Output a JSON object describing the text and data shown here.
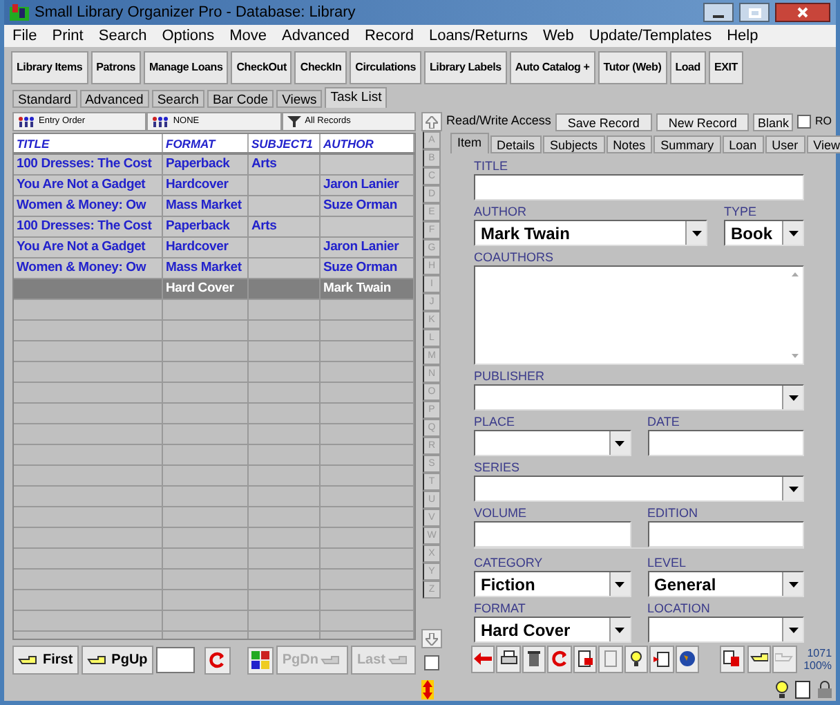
{
  "window": {
    "title": "Small Library Organizer Pro - Database: Library"
  },
  "menu": [
    "File",
    "Print",
    "Search",
    "Options",
    "Move",
    "Advanced",
    "Record",
    "Loans/Returns",
    "Web",
    "Update/Templates",
    "Help"
  ],
  "toolbar": [
    "Library Items",
    "Patrons",
    "Manage Loans",
    "CheckOut",
    "CheckIn",
    "Circulations",
    "Library Labels",
    "Auto Catalog +",
    "Tutor (Web)",
    "Load",
    "EXIT"
  ],
  "view_tabs": [
    {
      "label": "Standard",
      "selected": false
    },
    {
      "label": "Advanced",
      "selected": false
    },
    {
      "label": "Search",
      "selected": false
    },
    {
      "label": "Bar Code",
      "selected": false
    },
    {
      "label": "Views",
      "selected": false
    },
    {
      "label": "Task List",
      "selected": true
    }
  ],
  "sort_bar": [
    {
      "label": "Entry Order",
      "kind": "people"
    },
    {
      "label": "NONE",
      "kind": "people"
    },
    {
      "label": "All Records",
      "kind": "filter"
    }
  ],
  "table": {
    "columns": [
      "TITLE",
      "FORMAT",
      "SUBJECT1",
      "AUTHOR"
    ],
    "rows": [
      {
        "cells": [
          "100 Dresses: The Cost",
          "Paperback",
          "Arts",
          ""
        ],
        "selected": false
      },
      {
        "cells": [
          "You Are Not a Gadget",
          "Hardcover",
          "",
          "Jaron Lanier"
        ],
        "selected": false
      },
      {
        "cells": [
          "Women & Money: Ow",
          "Mass Market",
          "",
          "Suze Orman"
        ],
        "selected": false
      },
      {
        "cells": [
          "100 Dresses: The Cost",
          "Paperback",
          "Arts",
          ""
        ],
        "selected": false
      },
      {
        "cells": [
          "You Are Not a Gadget",
          "Hardcover",
          "",
          "Jaron Lanier"
        ],
        "selected": false
      },
      {
        "cells": [
          "Women & Money: Ow",
          "Mass Market",
          "",
          "Suze Orman"
        ],
        "selected": false
      },
      {
        "cells": [
          "",
          "Hard Cover",
          "",
          "Mark Twain"
        ],
        "selected": true
      }
    ]
  },
  "nav": [
    {
      "label": "First",
      "disabled": false
    },
    {
      "label": "PgUp",
      "disabled": false
    },
    {
      "label": "PgDn",
      "disabled": true
    },
    {
      "label": "Last",
      "disabled": true
    }
  ],
  "record_bar": {
    "access": "Read/Write Access",
    "buttons": [
      "Save Record",
      "New Record",
      "Blank"
    ],
    "ro": {
      "label": "RO",
      "checked": false
    }
  },
  "side_checkbox": {
    "checked": false
  },
  "letters": [
    "A",
    "B",
    "C",
    "D",
    "E",
    "F",
    "G",
    "H",
    "I",
    "J",
    "K",
    "L",
    "M",
    "N",
    "O",
    "P",
    "Q",
    "R",
    "S",
    "T",
    "U",
    "V",
    "W",
    "X",
    "Y",
    "Z"
  ],
  "detail_tabs": [
    {
      "label": "Item",
      "selected": true
    },
    {
      "label": "Details",
      "selected": false
    },
    {
      "label": "Subjects",
      "selected": false
    },
    {
      "label": "Notes",
      "selected": false
    },
    {
      "label": "Summary",
      "selected": false
    },
    {
      "label": "Loan",
      "selected": false
    },
    {
      "label": "User",
      "selected": false
    },
    {
      "label": "View",
      "selected": false
    }
  ],
  "form_rows": [
    [
      {
        "label": "TITLE",
        "kind": "text"
      }
    ],
    [
      {
        "label": "AUTHOR",
        "kind": "dropdown",
        "value": "Mark Twain"
      },
      {
        "label": "TYPE",
        "kind": "dropdown",
        "value": "Book"
      }
    ],
    [
      {
        "label": "COAUTHORS",
        "kind": "textarea"
      }
    ],
    [
      {
        "label": "PUBLISHER",
        "kind": "dropdown"
      }
    ],
    [
      {
        "label": "PLACE",
        "kind": "dropdown"
      },
      {
        "label": "DATE",
        "kind": "text"
      }
    ],
    [
      {
        "label": "SERIES",
        "kind": "dropdown"
      }
    ],
    [
      {
        "label": "VOLUME",
        "kind": "text"
      },
      {
        "label": "EDITION",
        "kind": "text"
      }
    ],
    [
      {
        "label": "CATEGORY",
        "kind": "dropdown",
        "value": "Fiction"
      },
      {
        "label": "LEVEL",
        "kind": "dropdown",
        "value": "General"
      }
    ],
    [
      {
        "label": "FORMAT",
        "kind": "dropdown",
        "value": "Hard Cover"
      },
      {
        "label": "LOCATION",
        "kind": "dropdown"
      }
    ]
  ],
  "counter": {
    "count": "1071",
    "zoom": "100%"
  }
}
